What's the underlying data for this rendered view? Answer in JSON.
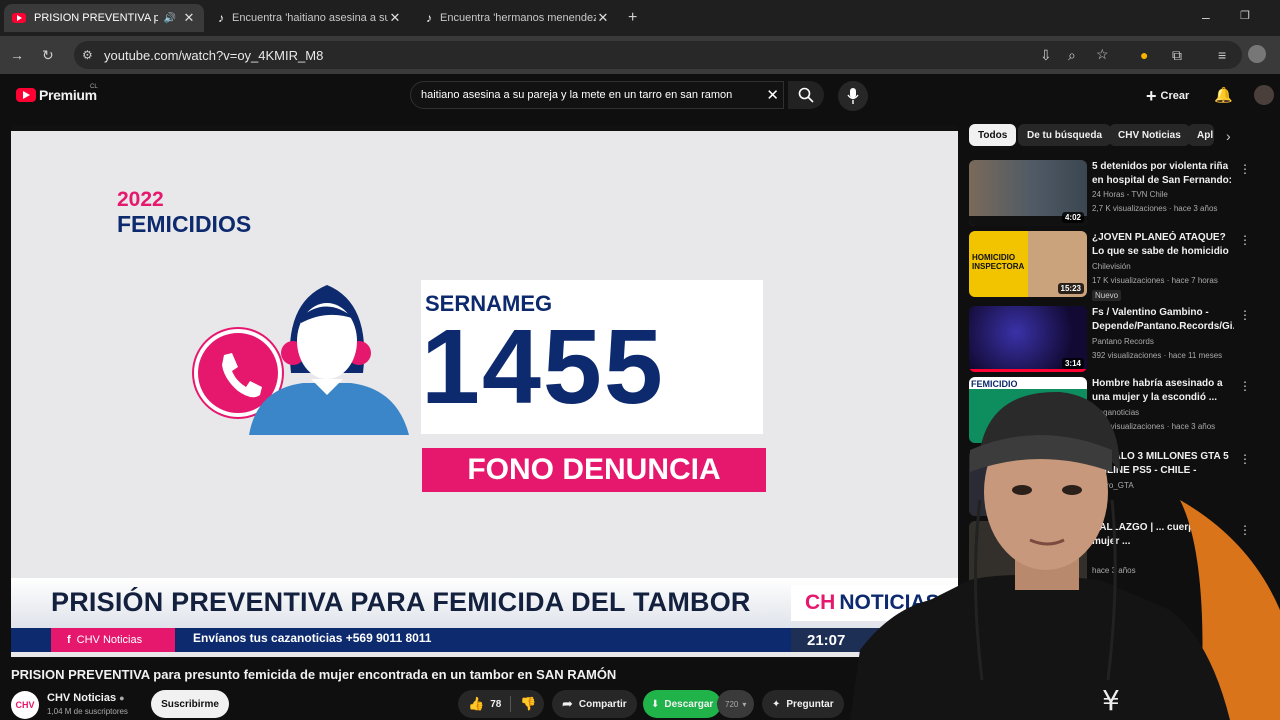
{
  "browser": {
    "tabs": [
      {
        "title": "PRISION PREVENTIVA para presunto femicida",
        "close": "✕"
      },
      {
        "title": "Encuentra 'haitiano asesina a su pareja",
        "close": "✕"
      },
      {
        "title": "Encuentra 'hermanos menendez",
        "close": "✕"
      }
    ],
    "new_tab": "+",
    "url": "youtube.com/watch?v=oy_4KMIR_M8"
  },
  "header": {
    "logo": "Premium",
    "logo_region": "CL",
    "search_value": "haitiano asesina a su pareja y la mete en un tarro en san ramon",
    "create_label": "Crear"
  },
  "video": {
    "year": "2022",
    "femicidios": "FEMICIDIOS",
    "sernameg": "SERNAMEG",
    "number": "1455",
    "fono": "FONO DENUNCIA",
    "banner": "PRISIÓN PREVENTIVA PARA FEMICIDA DEL TAMBOR",
    "brand_prefix": "CH",
    "brand": "NOTICIAS",
    "source": "CHV Noticias",
    "ticker": "Envíanos tus cazanoticias +569 9011 8011",
    "time": "21:07"
  },
  "info": {
    "title": "PRISION PREVENTIVA para presunto femicida de mujer encontrada en un tambor en SAN RAMÓN",
    "channel": "CHV Noticias",
    "subscribers": "1,04 M de suscriptores",
    "subscribe": "Suscribirme",
    "likes": "78",
    "share": "Compartir",
    "download": "Descargar",
    "quality": "720",
    "ask": "Preguntar"
  },
  "chips": [
    "Todos",
    "De tu búsqueda",
    "CHV Noticias",
    "Apl"
  ],
  "recommendations": [
    {
      "title": "5 detenidos por violenta riña en hospital de San Fernando: ...",
      "channel": "24 Horas - TVN Chile",
      "meta": "2,7 K visualizaciones · hace 3 años",
      "duration": "4:02",
      "badge": ""
    },
    {
      "title": "¿JOVEN PLANEÓ ATAQUE? Lo que se sabe de homicidio de ...",
      "channel": "Chilevisión",
      "meta": "17 K visualizaciones · hace 7 horas",
      "duration": "15:23",
      "badge": "Nuevo",
      "thumb_text": "HOMICIDIO INSPECTORA"
    },
    {
      "title": "Fs / Valentino Gambino - Depende/Pantano.Records/Gi...",
      "channel": "Pantano Records",
      "meta": "392 visualizaciones · hace 11 meses",
      "duration": "3:14",
      "badge": ""
    },
    {
      "title": "Hombre habría asesinado a una mujer y la escondió ...",
      "channel": "Meganoticias",
      "meta": "17 K visualizaciones · hace 3 años",
      "duration": "",
      "badge": "",
      "thumb_text": "FEMICIDIO"
    },
    {
      "title": "REGALO 3 MILLONES GTA 5 ONLINE PS5 - CHILE - TENGO ...",
      "channel": "Pedro_GTA",
      "meta": "",
      "duration": "",
      "badge": ""
    },
    {
      "title": "HALLAZGO | ... cuerpo de mujer ...",
      "channel": "",
      "meta": "hace 3 años",
      "duration": "",
      "badge": ""
    },
    {
      "title": "... ja de ...",
      "channel": "",
      "meta": "",
      "duration": "",
      "badge": ""
    }
  ],
  "colors": {
    "accent": "#e6186e",
    "navy": "#0d2a6e",
    "red": "#ff0033",
    "download": "#1fb34a"
  }
}
